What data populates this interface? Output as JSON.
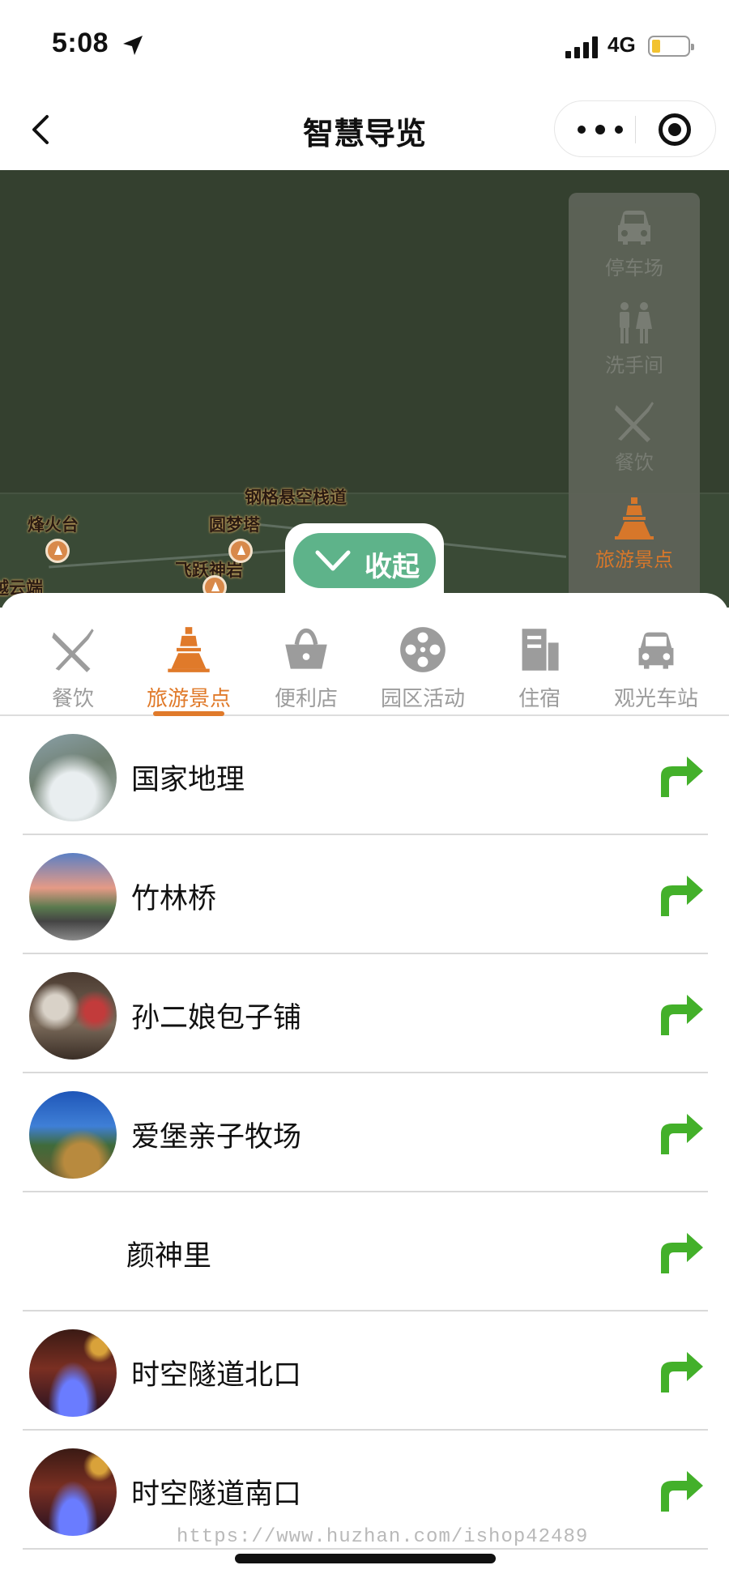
{
  "status": {
    "time": "5:08",
    "network": "4G"
  },
  "nav": {
    "title": "智慧导览"
  },
  "map": {
    "labels": [
      "钢格悬空栈道",
      "烽火台",
      "圆梦塔",
      "飞跃神岩",
      "越云端"
    ],
    "legend": [
      {
        "label": "停车场",
        "icon": "car-icon",
        "active": false
      },
      {
        "label": "洗手间",
        "icon": "restroom-icon",
        "active": false
      },
      {
        "label": "餐饮",
        "icon": "fork-knife-icon",
        "active": false
      },
      {
        "label": "旅游景点",
        "icon": "tower-icon",
        "active": true
      }
    ],
    "collapse_label": "收起"
  },
  "tabs": [
    {
      "label": "餐饮",
      "icon": "fork-knife-icon",
      "active": false
    },
    {
      "label": "旅游景点",
      "icon": "tower-icon",
      "active": true
    },
    {
      "label": "便利店",
      "icon": "basket-icon",
      "active": false
    },
    {
      "label": "园区活动",
      "icon": "film-reel-icon",
      "active": false
    },
    {
      "label": "住宿",
      "icon": "building-icon",
      "active": false
    },
    {
      "label": "观光车站",
      "icon": "car-icon",
      "active": false
    }
  ],
  "spots": [
    {
      "name": "国家地理"
    },
    {
      "name": "竹林桥"
    },
    {
      "name": "孙二娘包子铺"
    },
    {
      "name": "爱堡亲子牧场"
    },
    {
      "name": "颜神里"
    },
    {
      "name": "时空隧道北口"
    },
    {
      "name": "时空隧道南口"
    }
  ],
  "colors": {
    "accent": "#e07a2a",
    "direction": "#43b02a",
    "collapse": "#5eb38a",
    "map_bg": "#34402f"
  },
  "watermark": "https://www.huzhan.com/ishop42489"
}
